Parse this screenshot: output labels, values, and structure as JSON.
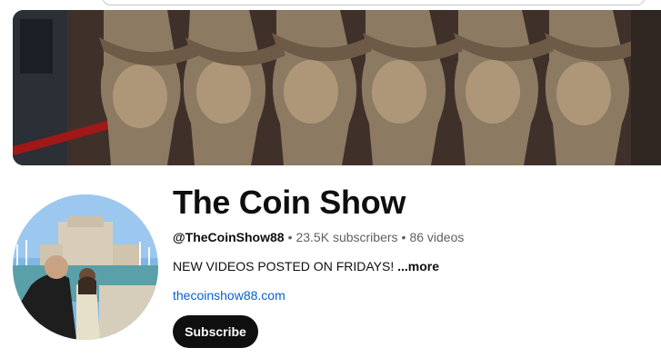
{
  "channel": {
    "title": "The Coin Show",
    "handle": "@TheCoinShow88",
    "separator": "•",
    "subscribers": "23.5K subscribers",
    "videos": "86 videos",
    "description": "NEW VIDEOS POSTED ON FRIDAYS!",
    "more_label": "...more",
    "link": "thecoinshow88.com",
    "subscribe_label": "Subscribe"
  },
  "colors": {
    "title_text": "#0f0f0f",
    "meta_text": "#606060",
    "link": "#065fd4",
    "subscribe_bg": "#0f0f0f",
    "subscribe_text": "#ffffff"
  }
}
